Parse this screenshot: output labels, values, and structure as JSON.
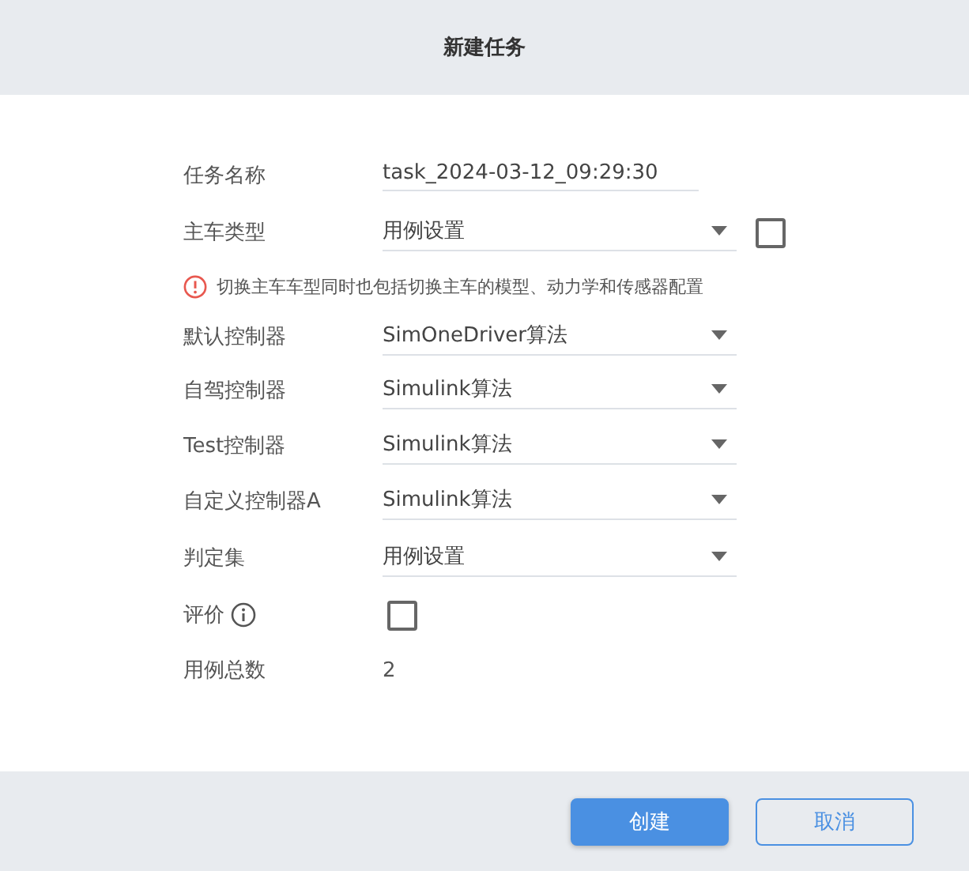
{
  "dialog": {
    "title": "新建任务"
  },
  "rows": [
    {
      "kind": "text",
      "label": "任务名称",
      "value": "task_2024-03-12_09:29:30"
    },
    {
      "kind": "select",
      "label": "主车类型",
      "value": "用例设置",
      "checked": false
    },
    {
      "kind": "warning",
      "text": "切换主车车型同时也包括切换主车的模型、动力学和传感器配置"
    },
    {
      "kind": "select",
      "label": "默认控制器",
      "value": "SimOneDriver算法"
    },
    {
      "kind": "select",
      "label": "自驾控制器",
      "value": "Simulink算法"
    },
    {
      "kind": "select",
      "label": "Test控制器",
      "value": "Simulink算法"
    },
    {
      "kind": "select",
      "label": "自定义控制器A",
      "value": "Simulink算法"
    },
    {
      "kind": "select",
      "label": "判定集",
      "value": "用例设置"
    },
    {
      "kind": "checkbox",
      "label": "评价",
      "info": true,
      "checked": false
    },
    {
      "kind": "static",
      "label": "用例总数",
      "value": "2"
    }
  ],
  "buttons": [
    {
      "kind": "primary",
      "label": "创建"
    },
    {
      "kind": "secondary",
      "label": "取消"
    }
  ]
}
